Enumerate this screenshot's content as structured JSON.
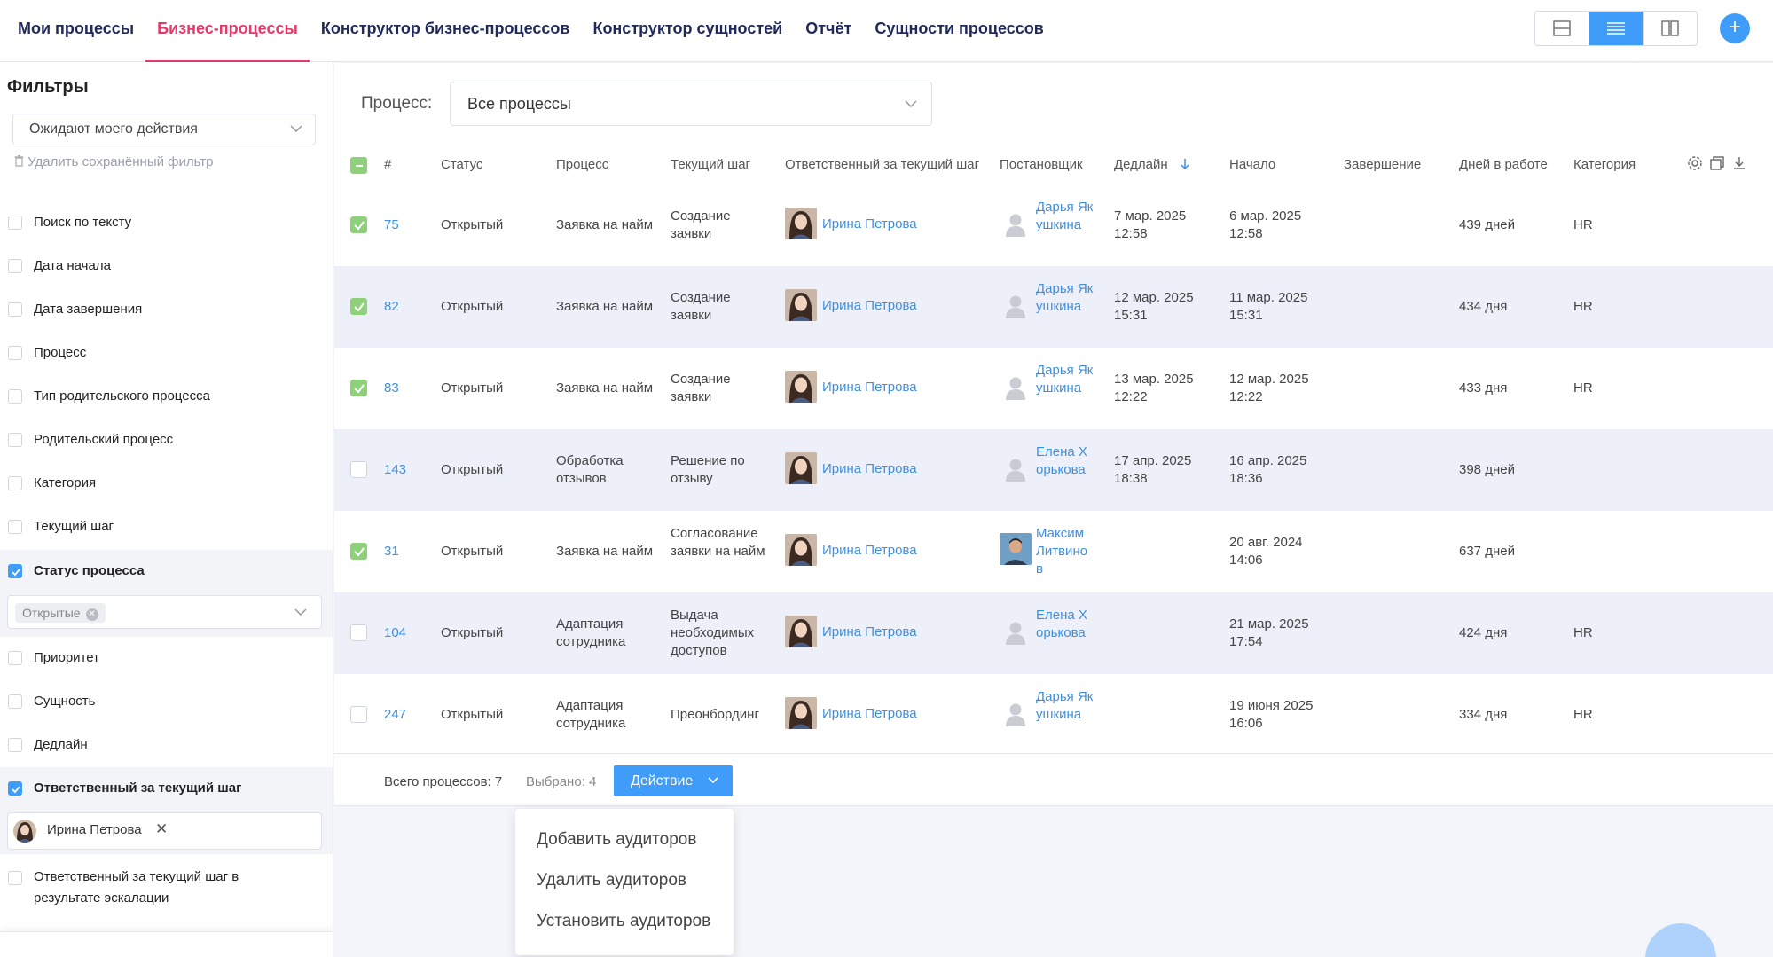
{
  "nav": {
    "tabs": [
      {
        "label": "Мои процессы",
        "active": false
      },
      {
        "label": "Бизнес-процессы",
        "active": true
      },
      {
        "label": "Конструктор бизнес-процессов",
        "active": false
      },
      {
        "label": "Конструктор сущностей",
        "active": false
      },
      {
        "label": "Отчёт",
        "active": false
      },
      {
        "label": "Сущности процессов",
        "active": false
      }
    ],
    "add_label": "+"
  },
  "sidebar": {
    "title": "Фильтры",
    "saved_filter": "Ожидают моего действия",
    "delete_filter": "Удалить сохранённый фильтр",
    "filters": [
      {
        "label": "Поиск по тексту",
        "checked": false
      },
      {
        "label": "Дата начала",
        "checked": false
      },
      {
        "label": "Дата завершения",
        "checked": false
      },
      {
        "label": "Процесс",
        "checked": false
      },
      {
        "label": "Тип родительского процесса",
        "checked": false
      },
      {
        "label": "Родительский процесс",
        "checked": false
      },
      {
        "label": "Категория",
        "checked": false
      },
      {
        "label": "Текущий шаг",
        "checked": false
      },
      {
        "label": "Статус процесса",
        "checked": true
      },
      {
        "label": "Приоритет",
        "checked": false
      },
      {
        "label": "Сущность",
        "checked": false
      },
      {
        "label": "Дедлайн",
        "checked": false
      },
      {
        "label": "Ответственный за текущий шаг",
        "checked": true
      },
      {
        "label": "Ответственный за текущий шаг в результате эскалации",
        "checked": false
      }
    ],
    "status_chip": "Открытые",
    "person_chip": "Ирина Петрова"
  },
  "main": {
    "process_label": "Процесс:",
    "process_value": "Все процессы",
    "columns": [
      "#",
      "Статус",
      "Процесс",
      "Текущий шаг",
      "Ответственный за текущий шаг",
      "Постановщик",
      "Дедлайн",
      "Начало",
      "Завершение",
      "Дней в работе",
      "Категория"
    ],
    "rows": [
      {
        "checked": true,
        "id": "75",
        "status": "Открытый",
        "process": "Заявка на найм",
        "step": "Создание заявки",
        "responsible": "Ирина Петрова",
        "author": "Дарья Якушкина",
        "author_photo": false,
        "deadline": "7 мар. 2025 12:58",
        "start": "6 мар. 2025 12:58",
        "end": "",
        "days": "439 дней",
        "category": "HR"
      },
      {
        "checked": true,
        "id": "82",
        "status": "Открытый",
        "process": "Заявка на найм",
        "step": "Создание заявки",
        "responsible": "Ирина Петрова",
        "author": "Дарья Якушкина",
        "author_photo": false,
        "deadline": "12 мар. 2025 15:31",
        "start": "11 мар. 2025 15:31",
        "end": "",
        "days": "434 дня",
        "category": "HR"
      },
      {
        "checked": true,
        "id": "83",
        "status": "Открытый",
        "process": "Заявка на найм",
        "step": "Создание заявки",
        "responsible": "Ирина Петрова",
        "author": "Дарья Якушкина",
        "author_photo": false,
        "deadline": "13 мар. 2025 12:22",
        "start": "12 мар. 2025 12:22",
        "end": "",
        "days": "433 дня",
        "category": "HR"
      },
      {
        "checked": false,
        "id": "143",
        "status": "Открытый",
        "process": "Обработка отзывов",
        "step": "Решение по отзыву",
        "responsible": "Ирина Петрова",
        "author": "Елена Хорькова",
        "author_photo": false,
        "deadline": "17 апр. 2025 18:38",
        "start": "16 апр. 2025 18:36",
        "end": "",
        "days": "398 дней",
        "category": ""
      },
      {
        "checked": true,
        "id": "31",
        "status": "Открытый",
        "process": "Заявка на найм",
        "step": "Согласование заявки на найм",
        "responsible": "Ирина Петрова",
        "author": "Максим Литвинов",
        "author_photo": true,
        "deadline": "",
        "start": "20 авг. 2024 14:06",
        "end": "",
        "days": "637 дней",
        "category": ""
      },
      {
        "checked": false,
        "id": "104",
        "status": "Открытый",
        "process": "Адаптация сотрудника",
        "step": "Выдача необходимых доступов",
        "responsible": "Ирина Петрова",
        "author": "Елена Хорькова",
        "author_photo": false,
        "deadline": "",
        "start": "21 мар. 2025 17:54",
        "end": "",
        "days": "424 дня",
        "category": "HR"
      },
      {
        "checked": false,
        "id": "247",
        "status": "Открытый",
        "process": "Адаптация сотрудника",
        "step": "Преонбординг",
        "responsible": "Ирина Петрова",
        "author": "Дарья Якушкина",
        "author_photo": false,
        "deadline": "",
        "start": "19 июня 2025 16:06",
        "end": "",
        "days": "334 дня",
        "category": "HR"
      }
    ]
  },
  "footer": {
    "total": "Всего процессов: 7",
    "selected": "Выбрано: 4",
    "action": "Действие"
  },
  "action_menu": {
    "items": [
      "Добавить аудиторов",
      "Удалить аудиторов",
      "Установить аудиторов"
    ]
  },
  "colors": {
    "accent": "#3f9cf9",
    "active_tab": "#e63a6a",
    "link": "#3f8fe0",
    "checkbox_green": "#8fd07a"
  }
}
